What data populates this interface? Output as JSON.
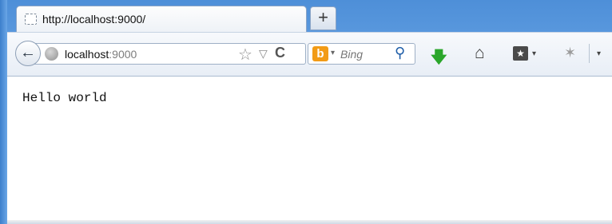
{
  "tab": {
    "title": "http://localhost:9000/",
    "new_tab_label": "+"
  },
  "navbar": {
    "back_icon": "back-arrow-icon",
    "url_host": "localhost",
    "url_port": ":9000",
    "search_placeholder": "Bing",
    "search_engine_icon": "bing-icon"
  },
  "icons": {
    "back": "←",
    "star": "☆",
    "dropmarker": "▽",
    "reload": "C",
    "bing": "b",
    "search_dropdown": "▾",
    "search_go": "⚲",
    "download": "🡇",
    "home": "⌂",
    "bookmarks": "★",
    "bookmarks_drop": "▾",
    "addon": "✶",
    "menu_drop": "▾"
  },
  "page": {
    "body_text": "Hello world"
  },
  "colors": {
    "frame": "#5e9be0",
    "bing": "#f29b16",
    "download": "#2aa62a"
  }
}
